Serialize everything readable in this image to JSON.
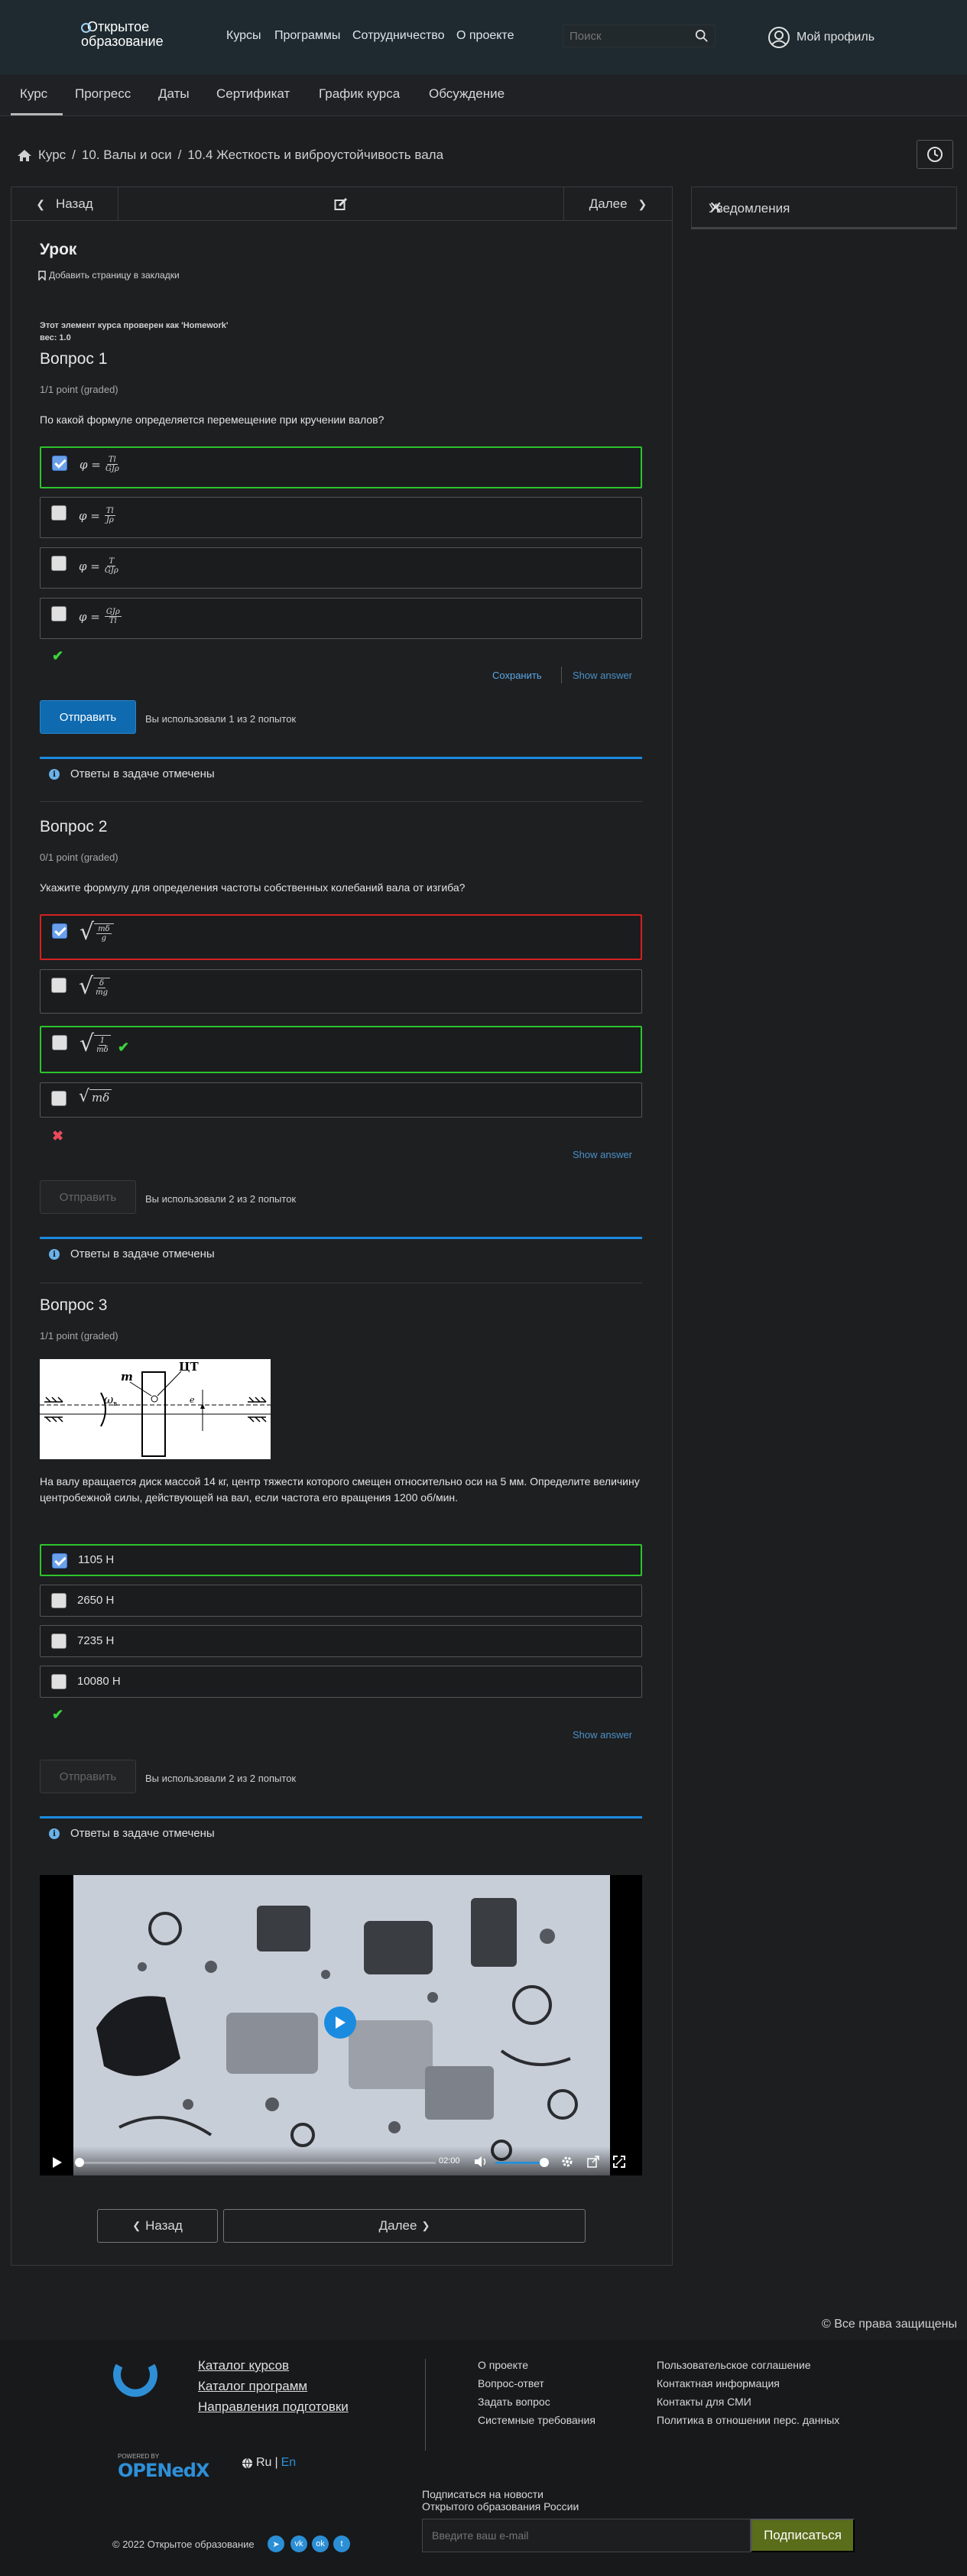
{
  "header": {
    "logo_line1": "Открытое",
    "logo_line2": "образование",
    "nav": [
      "Курсы",
      "Программы",
      "Сотрудничество",
      "О проекте"
    ],
    "search_placeholder": "Поиск",
    "profile_label": "Мой профиль"
  },
  "course_tabs": [
    "Курс",
    "Прогресс",
    "Даты",
    "Сертификат",
    "График курса",
    "Обсуждение"
  ],
  "breadcrumb": [
    "Курс",
    "10. Валы и оси",
    "10.4 Жесткость и виброустойчивость вала"
  ],
  "sequence": {
    "prev": "Назад",
    "next": "Далее"
  },
  "notifications": {
    "title": "Уведомления"
  },
  "lesson": {
    "title": "Урок",
    "bookmark": "Добавить страницу в закладки",
    "graded_note_1": "Этот элемент курса проверен как 'Homework'",
    "graded_note_2": "вес: 1.0"
  },
  "q1": {
    "title": "Вопрос 1",
    "points": "1/1 point (graded)",
    "text": "По какой формуле определяется перемещение при кручении валов?",
    "options": [
      {
        "num": "Tl",
        "den": "GJρ",
        "checked": true
      },
      {
        "num": "Tl",
        "den": "Jρ",
        "checked": false
      },
      {
        "num": "T",
        "den": "GJρ",
        "checked": false
      },
      {
        "num": "GJρ",
        "den": "Tl",
        "checked": false
      }
    ],
    "save": "Сохранить",
    "show_answer": "Show answer",
    "submit": "Отправить",
    "attempts": "Вы использовали 1 из 2 попыток",
    "notice": "Ответы в задаче отмечены"
  },
  "q2": {
    "title": "Вопрос 2",
    "points": "0/1 point (graded)",
    "text": "Укажите формулу для определения частоты собственных колебаний вала от изгиба?",
    "options": [
      {
        "num": "mδ",
        "den": "g",
        "checked": true
      },
      {
        "num": "δ",
        "den": "mg",
        "checked": false
      },
      {
        "num": "1",
        "den": "mδ",
        "checked": false
      },
      {
        "plain": "mδ",
        "checked": false
      }
    ],
    "show_answer": "Show answer",
    "submit": "Отправить",
    "attempts": "Вы использовали 2 из 2 попыток",
    "notice": "Ответы в задаче отмечены"
  },
  "q3": {
    "title": "Вопрос 3",
    "points": "1/1 point (graded)",
    "figure_labels": {
      "m": "m",
      "omega": "ω",
      "omega_sub": "в",
      "ct": "ЦТ",
      "e": "e"
    },
    "text": "На валу вращается диск массой 14 кг, центр тяжести которого смещен относительно оси на 5 мм. Определите величину центробежной силы, действующей на вал, если частота его вращения 1200 об/мин.",
    "options": [
      "1105 Н",
      "2650 Н",
      "7235 Н",
      "10080 Н"
    ],
    "show_answer": "Show answer",
    "submit": "Отправить",
    "attempts": "Вы использовали 2 из 2 попыток",
    "notice": "Ответы в задаче отмечены"
  },
  "video": {
    "time": "02:00"
  },
  "bottom_nav": {
    "prev": "Назад",
    "next": "Далее"
  },
  "footer": {
    "rights": "Все права защищены",
    "links_col1": [
      "Каталог курсов",
      "Каталог программ",
      "Направления подготовки"
    ],
    "links_col2": [
      "О проекте",
      "Вопрос-ответ",
      "Задать вопрос",
      "Системные требования"
    ],
    "links_col3": [
      "Пользовательское соглашение",
      "Контактная информация",
      "Контакты для СМИ",
      "Политика в отношении перс. данных"
    ],
    "powered_by": "POWERED BY",
    "openedx": "OPENedX",
    "lang_ru": "Ru",
    "lang_sep": "|",
    "lang_en": "En",
    "subscribe_line1": "Подписаться на новости",
    "subscribe_line2": "Открытого образования России",
    "email_placeholder": "Введите ваш e-mail",
    "subscribe_btn": "Подписаться",
    "copyright": "© 2022 Открытое образование"
  },
  "colors": {
    "correct": "#2cc52c",
    "incorrect": "#d42121",
    "accent": "#1b8be0",
    "subscribe": "#5a6d1a"
  }
}
